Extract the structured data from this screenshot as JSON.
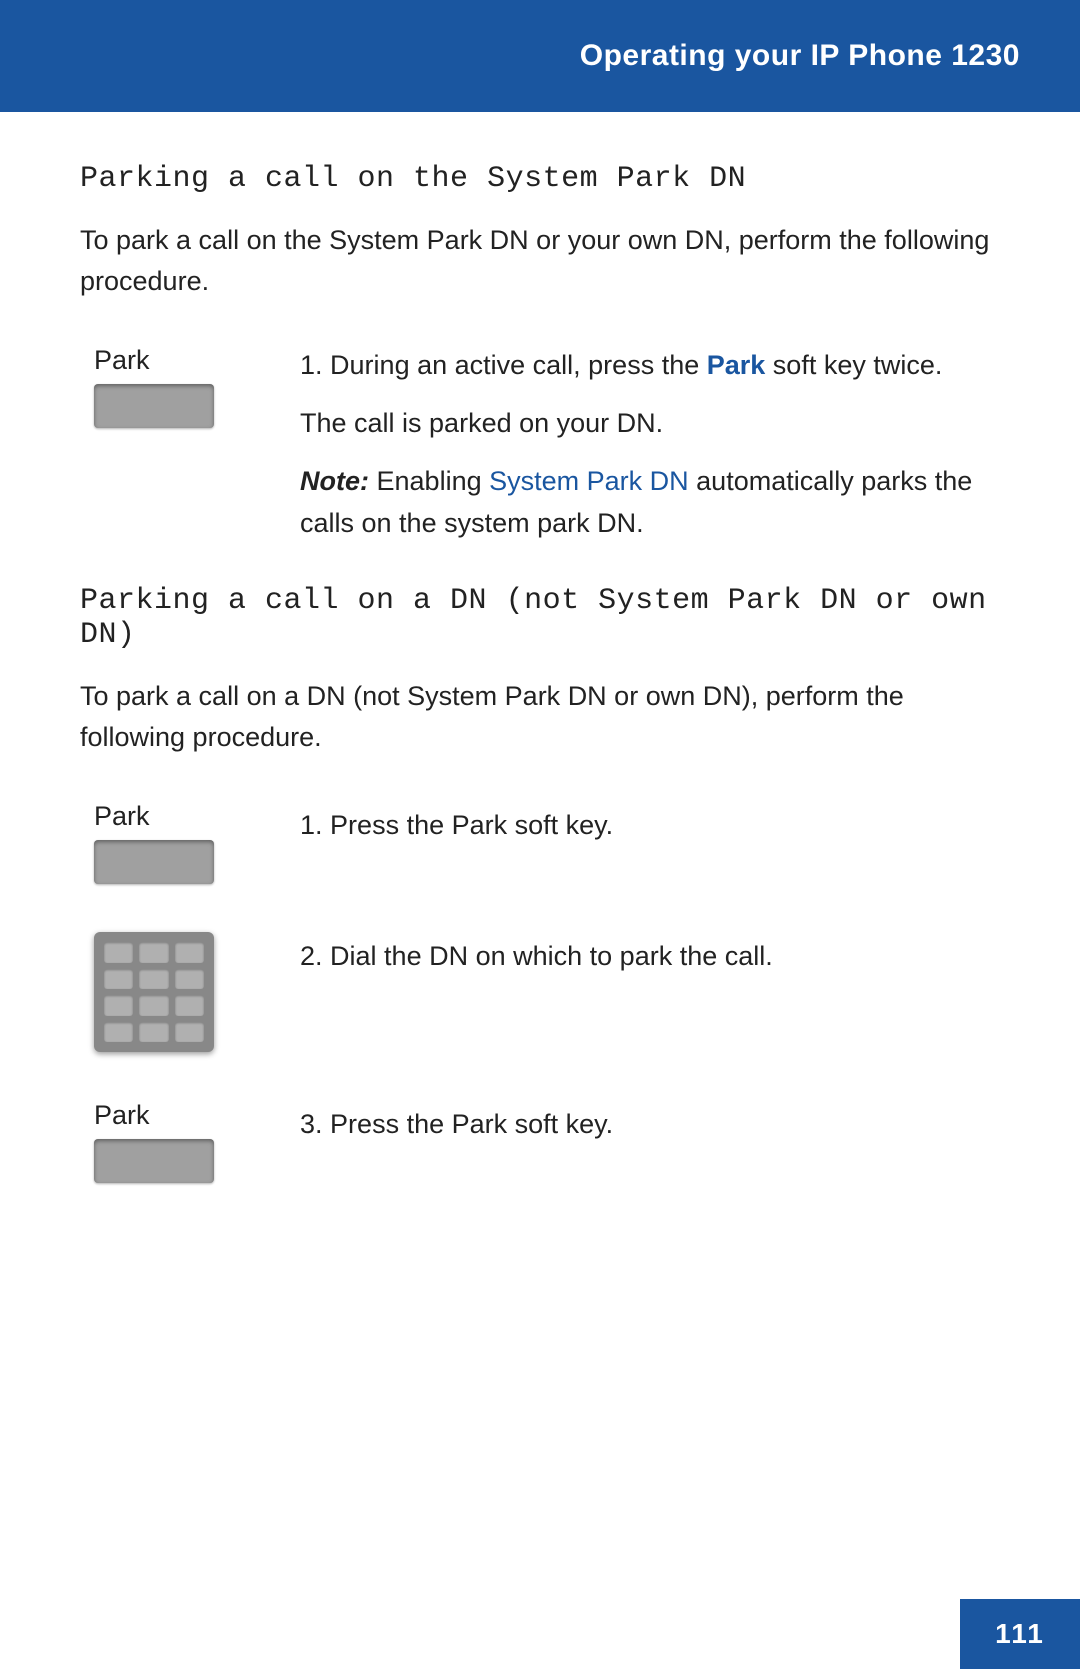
{
  "header": {
    "title": "Operating your IP Phone ",
    "phone_model": "1230"
  },
  "section1": {
    "heading": "Parking a call on the System Park DN",
    "intro": "To park a call on the System Park DN or your own DN, perform the following procedure.",
    "step1": {
      "icon_label": "Park",
      "number": "1.",
      "text_before_link": "During an active call, press the ",
      "link_text": "Park",
      "text_after_link": " soft key twice."
    },
    "call_parked": "The call is parked on your DN.",
    "note_label": "Note:",
    "note_enabling": "Enabling ",
    "note_link_text": "System Park DN",
    "note_rest": " automatically parks the calls on the system park DN."
  },
  "section2": {
    "heading": "Parking a call on a DN (not System Park DN or own DN)",
    "intro": "To park a call on a DN (not System Park DN or own DN), perform the following procedure.",
    "step1": {
      "icon_label": "Park",
      "number": "1.",
      "text_before_link": "Press the ",
      "link_text": "Park",
      "text_after_link": " soft key."
    },
    "step2": {
      "number": "2.",
      "text": "Dial the DN on which to park the call."
    },
    "step3": {
      "icon_label": "Park",
      "number": "3.",
      "text_before_link": "Press the ",
      "link_text": "Park",
      "text_after_link": " soft key."
    }
  },
  "page_number": "111"
}
